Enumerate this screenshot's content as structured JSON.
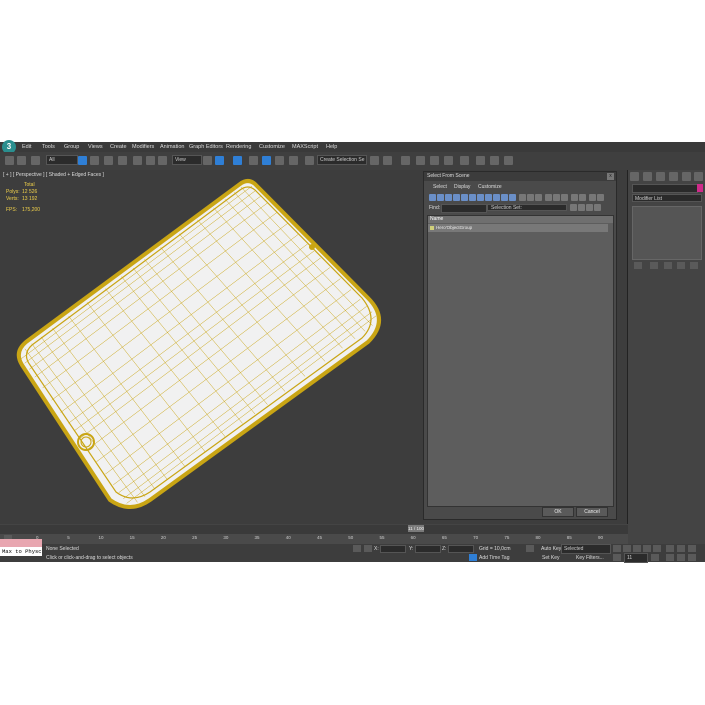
{
  "menu": [
    "Edit",
    "Tools",
    "Group",
    "Views",
    "Create",
    "Modifiers",
    "Animation",
    "Graph Editors",
    "Rendering",
    "Customize",
    "MAXScript",
    "Help"
  ],
  "toolbar": {
    "filter_value": "All",
    "refcoord_value": "View",
    "named_selection": "Create Selection Se"
  },
  "viewport": {
    "label": "[ + ] [ Perspective ] [ Shaded + Edged Faces ]",
    "stats": {
      "header": "Total",
      "polys_label": "Polys:",
      "polys_value": "12 526",
      "verts_label": "Verts:",
      "verts_value": "13 192",
      "fps_label": "FPS:",
      "fps_value": "175,200"
    },
    "colors": {
      "wire": "#c9a514",
      "surface": "#f1f1f1",
      "background": "#3d3d3d"
    }
  },
  "command_panel": {
    "modifier_list": "Modifier List"
  },
  "dialog": {
    "title": "Select From Scene",
    "close_glyph": "x",
    "menus": [
      "Select",
      "Display",
      "Customize"
    ],
    "find_label": "Find:",
    "selection_set": "Selection Set:",
    "column_name": "Name",
    "objects": [
      "Hero'ObjectGroup"
    ],
    "ok": "OK",
    "cancel": "Cancel"
  },
  "timeline": {
    "slider": "11 / 100",
    "ticks": [
      "0",
      "5",
      "10",
      "15",
      "20",
      "25",
      "30",
      "35",
      "40",
      "45",
      "50",
      "55",
      "60",
      "65",
      "70",
      "75",
      "80",
      "85",
      "90"
    ]
  },
  "status": {
    "maxscript": "Max to Physc",
    "selection": "None Selected",
    "prompt": "Click or click-and-drag to select objects",
    "x_label": "X:",
    "y_label": "Y:",
    "z_label": "Z:",
    "grid": "Grid = 10,0cm",
    "add_time_tag": "Add Time Tag",
    "auto_key": "Auto Key",
    "auto_key_value": "Selected",
    "set_key": "Set Key",
    "key_filters": "Key Filters...",
    "frame_value": "11"
  }
}
